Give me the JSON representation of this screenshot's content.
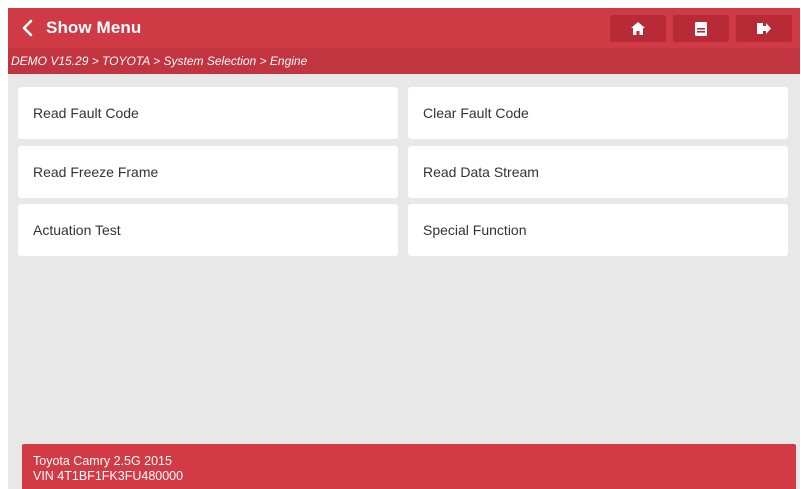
{
  "header": {
    "title": "Show Menu"
  },
  "breadcrumb": "DEMO V15.29 > TOYOTA > System Selection > Engine",
  "menu": [
    {
      "label": "Read Fault Code"
    },
    {
      "label": "Clear Fault Code"
    },
    {
      "label": "Read Freeze Frame"
    },
    {
      "label": "Read Data Stream"
    },
    {
      "label": "Actuation Test"
    },
    {
      "label": "Special Function"
    }
  ],
  "vehicle": {
    "model": "Toyota Camry 2.5G 2015",
    "vin": "VIN 4T1BF1FK3FU480000"
  },
  "icons": [
    "chevron-left-icon",
    "home-icon",
    "print-icon",
    "exit-icon"
  ],
  "colors": {
    "accent": "#cf3a45",
    "breadcrumb_bg": "#c23440",
    "footer_bg": "#d23a46",
    "background": "#e8e8e8"
  }
}
